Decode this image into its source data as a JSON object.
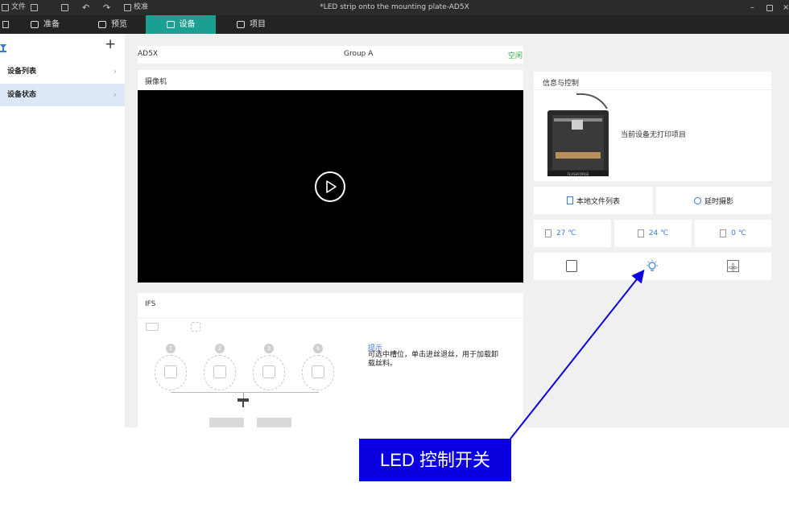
{
  "titlebar": {
    "file_label": "文件",
    "calibrate_label": "校准",
    "window_title": "*LED strip onto the mounting plate-AD5X"
  },
  "tabs": [
    {
      "label": "准备",
      "active": false
    },
    {
      "label": "预览",
      "active": false
    },
    {
      "label": "设备",
      "active": true
    },
    {
      "label": "项目",
      "active": false
    }
  ],
  "sidebar": {
    "items": [
      {
        "label": "设备列表",
        "active": false
      },
      {
        "label": "设备状态",
        "active": true
      }
    ]
  },
  "device_header": {
    "name": "AD5X",
    "group": "Group A",
    "status": "空闲",
    "status_color": "#2eaa3a"
  },
  "camera": {
    "title": "摄像机"
  },
  "info": {
    "title": "信息与控制",
    "no_job_text": "当前设备无打印项目",
    "local_files_label": "本地文件列表",
    "timelapse_label": "延时摄影"
  },
  "temps": {
    "nozzle": "27 ℃",
    "bed": "24 ℃",
    "chamber": "0 ℃"
  },
  "ifs": {
    "title": "IFS",
    "slots": [
      "1",
      "2",
      "3",
      "4"
    ],
    "hint_title": "提示",
    "hint_text": "可选中槽位，单击进丝退丝，用于加载卸载丝料。"
  },
  "annotation": {
    "label": "LED 控制开关",
    "color": "#0b00e0"
  },
  "accent_color": "#1aa092"
}
